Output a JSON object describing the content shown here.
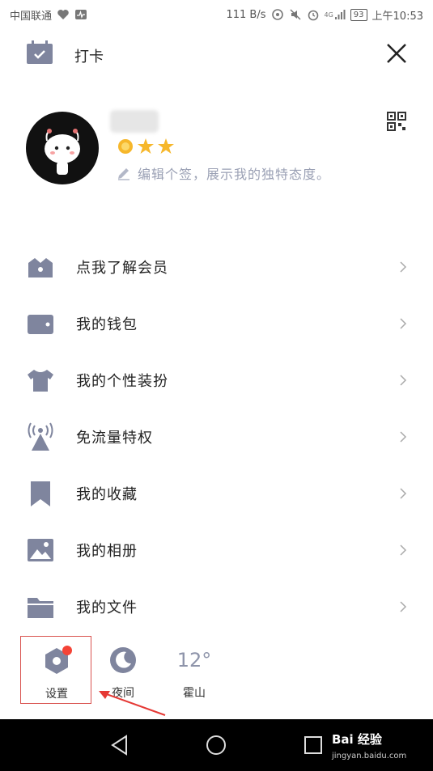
{
  "statusbar": {
    "carrier": "中国联通",
    "speed": "111 B/s",
    "network": "4G",
    "battery": "93",
    "time": "上午10:53"
  },
  "header": {
    "punch_label": "打卡",
    "punch_icon": "calendar-check-icon",
    "close_icon": "close-icon"
  },
  "profile": {
    "stars": 3,
    "signature": "编辑个签，展示我的独特态度。",
    "signature_icon": "pencil-icon",
    "qr_icon": "qr-code-icon"
  },
  "menu": {
    "items": [
      {
        "label": "点我了解会员",
        "icon": "crown-icon"
      },
      {
        "label": "我的钱包",
        "icon": "wallet-icon"
      },
      {
        "label": "我的个性装扮",
        "icon": "tshirt-icon"
      },
      {
        "label": "免流量特权",
        "icon": "signal-tower-icon"
      },
      {
        "label": "我的收藏",
        "icon": "bookmark-icon"
      },
      {
        "label": "我的相册",
        "icon": "photo-icon"
      },
      {
        "label": "我的文件",
        "icon": "folder-icon"
      }
    ]
  },
  "bottom": {
    "settings_label": "设置",
    "night_label": "夜间",
    "weather_temp": "12°",
    "weather_city": "霍山"
  },
  "watermark": {
    "brand": "Bai 经验",
    "url": "jingyan.baidu.com"
  },
  "colors": {
    "icon": "#7f859e",
    "badge": "#f44336",
    "highlight": "#d9534f"
  }
}
